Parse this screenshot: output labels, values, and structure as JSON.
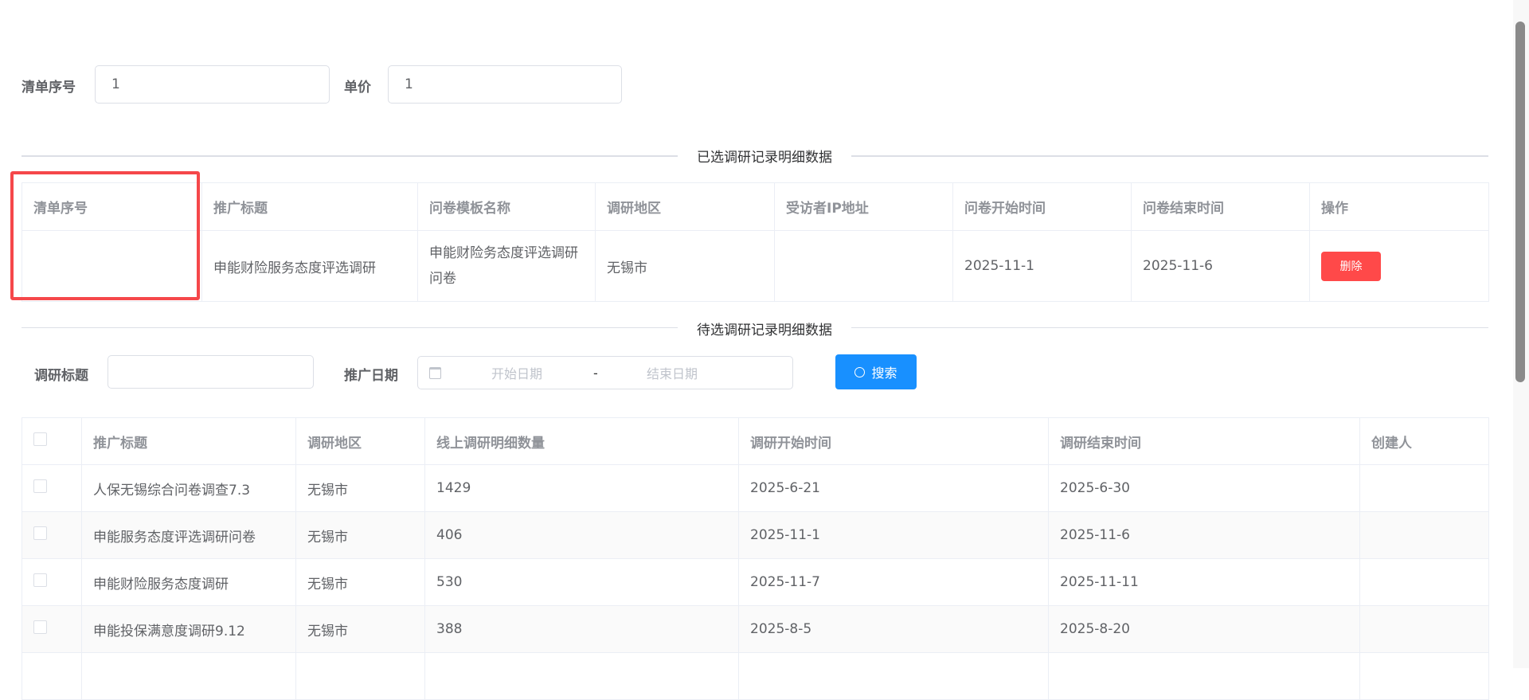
{
  "form": {
    "list_no_label": "清单序号",
    "list_no_value": "1",
    "price_label": "单价",
    "price_value": "1"
  },
  "selected": {
    "divider": "已选调研记录明细数据",
    "columns": [
      "清单序号",
      "推广标题",
      "问卷模板名称",
      "调研地区",
      "受访者IP地址",
      "问卷开始时间",
      "问卷结束时间",
      "操作"
    ],
    "rows": [
      {
        "no": "",
        "title": "申能财险服务态度评选调研",
        "template": "申能财险务态度评选调研问卷",
        "region": "无锡市",
        "ip": "",
        "start": "2025-11-1",
        "end": "2025-11-6",
        "action": "删除"
      }
    ]
  },
  "pending": {
    "divider": "待选调研记录明细数据",
    "filters": {
      "title_label": "调研标题",
      "title_value": "",
      "date_label": "推广日期",
      "start_placeholder": "开始日期",
      "sep": "-",
      "end_placeholder": "结束日期",
      "search": "搜索"
    },
    "columns": [
      "推广标题",
      "调研地区",
      "线上调研明细数量",
      "调研开始时间",
      "调研结束时间",
      "创建人"
    ],
    "rows": [
      {
        "title": "人保无锡综合问卷调查7.3",
        "region": "无锡市",
        "count": "1429",
        "start": "2025-6-21",
        "end": "2025-6-30",
        "creator": ""
      },
      {
        "title": "申能服务态度评选调研问卷",
        "region": "无锡市",
        "count": "406",
        "start": "2025-11-1",
        "end": "2025-11-6",
        "creator": ""
      },
      {
        "title": "申能财险服务态度调研",
        "region": "无锡市",
        "count": "530",
        "start": "2025-11-7",
        "end": "2025-11-11",
        "creator": ""
      },
      {
        "title": "申能投保满意度调研9.12",
        "region": "无锡市",
        "count": "388",
        "start": "2025-8-5",
        "end": "2025-8-20",
        "creator": ""
      }
    ]
  },
  "colors": {
    "primary": "#1890ff",
    "danger": "#ff4949",
    "highlight": "#f5474a"
  }
}
